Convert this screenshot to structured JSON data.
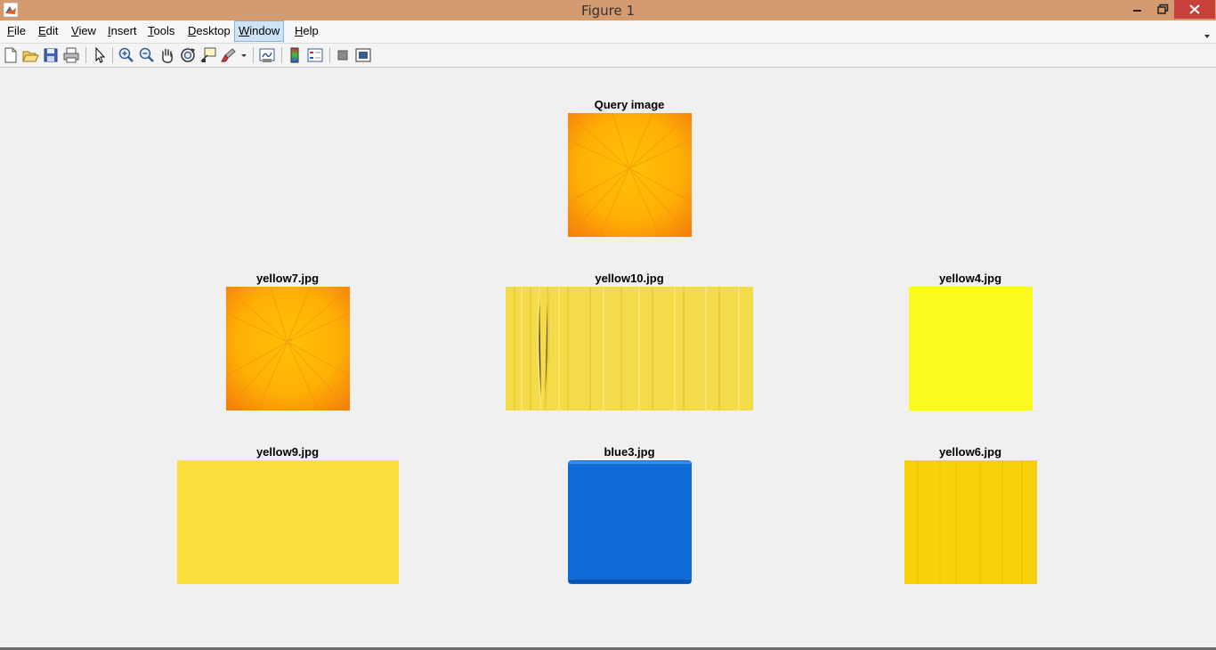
{
  "window": {
    "title": "Figure 1"
  },
  "menu": [
    {
      "pre": "",
      "key": "F",
      "post": "ile"
    },
    {
      "pre": "",
      "key": "E",
      "post": "dit"
    },
    {
      "pre": "",
      "key": "V",
      "post": "iew"
    },
    {
      "pre": "",
      "key": "I",
      "post": "nsert"
    },
    {
      "pre": "",
      "key": "T",
      "post": "ools"
    },
    {
      "pre": "",
      "key": "D",
      "post": "esktop"
    },
    {
      "pre": "",
      "key": "W",
      "post": "indow"
    },
    {
      "pre": "",
      "key": "H",
      "post": "elp"
    }
  ],
  "toolbar_icons": [
    "new-figure-icon",
    "open-file-icon",
    "save-icon",
    "print-icon",
    "edit-plot-arrow-icon",
    "zoom-in-icon",
    "zoom-out-icon",
    "pan-hand-icon",
    "rotate-3d-icon",
    "data-cursor-icon",
    "brush-icon",
    "link-plot-icon",
    "insert-colorbar-icon",
    "insert-legend-icon",
    "hide-plot-tools-icon",
    "show-plot-tools-icon"
  ],
  "figure": {
    "query_title": "Query image",
    "results": [
      {
        "title": "yellow7.jpg"
      },
      {
        "title": "yellow10.jpg"
      },
      {
        "title": "yellow4.jpg"
      },
      {
        "title": "yellow9.jpg"
      },
      {
        "title": "blue3.jpg"
      },
      {
        "title": "yellow6.jpg"
      }
    ]
  },
  "colors": {
    "titlebar": "#d59b70",
    "close_button": "#c7413a",
    "burst_center": "#ffc107",
    "burst_edge": "#f37a0c",
    "yellow10": "#f3db4a",
    "yellow4": "#ffff2a",
    "yellow9": "#fcdf3c",
    "blue3": "#0f6bd6",
    "yellow6": "#f8d10a"
  }
}
